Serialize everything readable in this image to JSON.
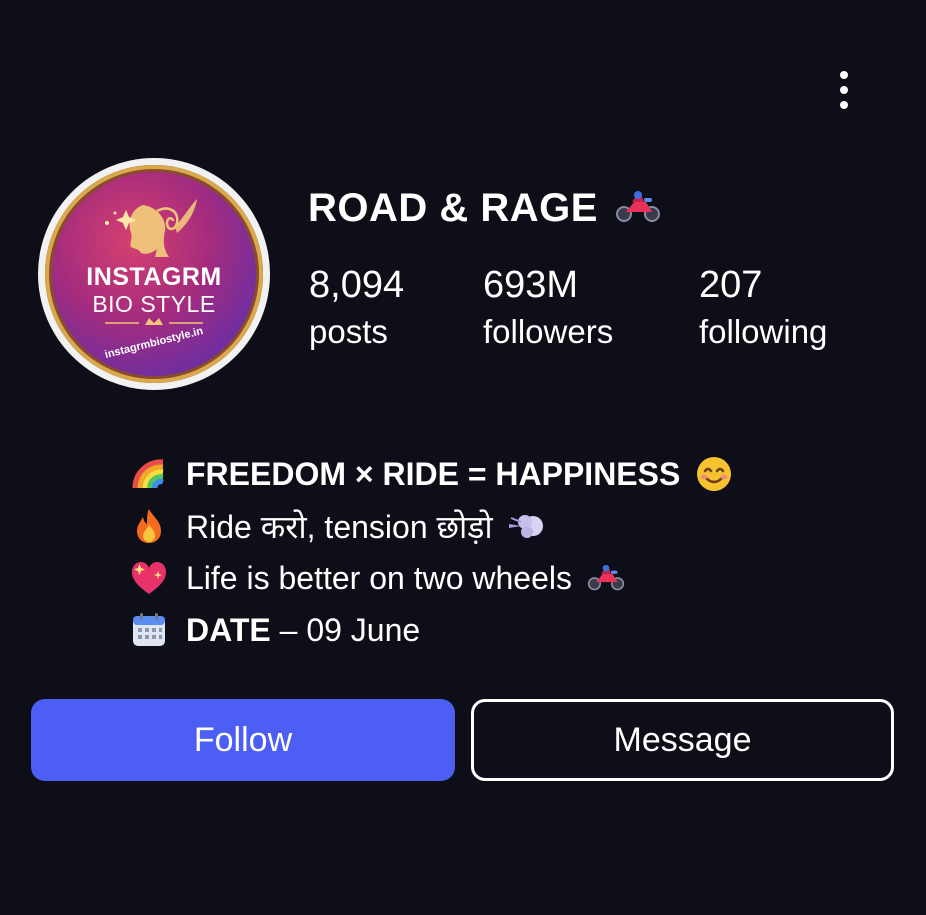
{
  "header": {
    "menu_icon": "more-vertical-icon"
  },
  "profile": {
    "avatar_logo": {
      "line1": "INSTAGRM",
      "line2": "BIO STYLE",
      "url": "instagrmbiostyle.in"
    },
    "name": "ROAD & RAGE",
    "name_icon": "motorcycle-icon",
    "stats": {
      "posts": {
        "value": "8,094",
        "label": "posts"
      },
      "followers": {
        "value": "693M",
        "label": "followers"
      },
      "following": {
        "value": "207",
        "label": "following"
      }
    }
  },
  "bio": {
    "line1": {
      "icon": "rainbow-icon",
      "bold": "FREEDOM × RIDE = HAPPINESS",
      "icon_after": "smiling-face-icon"
    },
    "line2": {
      "icon": "fire-icon",
      "text": "Ride करो, tension छोड़ो",
      "icon_after": "dash-icon"
    },
    "line3": {
      "icon": "sparkling-heart-icon",
      "text": "Life is better on two wheels",
      "icon_after": "motorcycle-icon"
    },
    "line4": {
      "icon": "calendar-icon",
      "bold": "DATE",
      "text": " – 09 June"
    }
  },
  "actions": {
    "follow_label": "Follow",
    "message_label": "Message"
  },
  "colors": {
    "background": "#0d0e17",
    "follow_button": "#4d5ef5",
    "text": "#ffffff"
  }
}
